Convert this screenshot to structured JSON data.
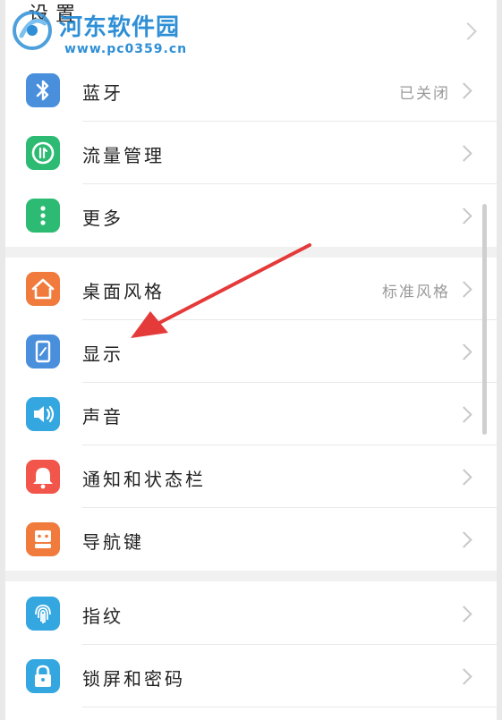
{
  "header": {
    "title": "设置"
  },
  "watermark": {
    "name": "河东软件园",
    "url": "www.pc0359.cn"
  },
  "colors": {
    "bluetooth": "#4a8fdc",
    "traffic": "#2dbb73",
    "more": "#2dbb73",
    "theme": "#f07b3c",
    "display": "#4a8fdc",
    "sound": "#35a7e0",
    "notify": "#f2554a",
    "navkeys": "#f07b3c",
    "fingerprint": "#35a7e0",
    "lock": "#35a7e0",
    "arrow": "#e53a3a"
  },
  "settings": [
    {
      "label": "蓝牙",
      "value": "已关闭",
      "icon": "bluetooth-icon"
    },
    {
      "label": "流量管理",
      "value": "",
      "icon": "data-traffic-icon"
    },
    {
      "label": "更多",
      "value": "",
      "icon": "more-dots-icon"
    },
    {
      "label": "桌面风格",
      "value": "标准风格",
      "icon": "home-icon"
    },
    {
      "label": "显示",
      "value": "",
      "icon": "display-icon"
    },
    {
      "label": "声音",
      "value": "",
      "icon": "speaker-icon"
    },
    {
      "label": "通知和状态栏",
      "value": "",
      "icon": "bell-icon"
    },
    {
      "label": "导航键",
      "value": "",
      "icon": "nav-keys-icon"
    },
    {
      "label": "指纹",
      "value": "",
      "icon": "fingerprint-icon"
    },
    {
      "label": "锁屏和密码",
      "value": "",
      "icon": "lock-icon"
    }
  ]
}
